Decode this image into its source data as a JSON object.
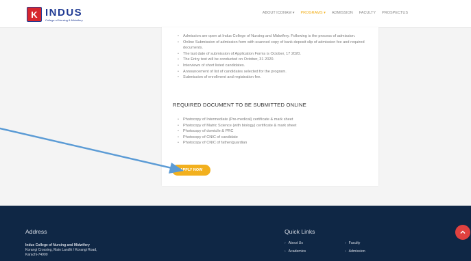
{
  "header": {
    "logo_letter": "K",
    "logo_title": "INDUS",
    "logo_subtitle": "College of Nursing & Midwifery",
    "nav": [
      {
        "label": "ABOUT ICONAM ▾"
      },
      {
        "label": "PROGRAMS ▾"
      },
      {
        "label": "ADMISSION"
      },
      {
        "label": "FACULTY"
      },
      {
        "label": "PROSPECTUS"
      }
    ]
  },
  "card": {
    "process_items": [
      "Admission are open at Indus College of Nursing and Midwifery. Following is the process of admission.",
      "Online Submission of admission form with scanned copy of bank deposit slip of admission fee and required documents.",
      "The last date of submission of Application Forms is October, 17 2020.",
      "The Entry test will be conducted on October, 31 2020.",
      "Interviews of short listed candidates.",
      "Announcement of list of candidates selected for the program.",
      "Submission of enrollment and registration fee."
    ],
    "section_title": "REQUIRED DOCUMENT TO BE SUBMITTED ONLINE",
    "document_items": [
      "Photocopy of Intermediate (Pre-medical) certificate & mark sheet",
      "Photocopy of Matric Science (with biology) certificate & mark sheet",
      "Photocopy of domicile & PRC",
      "Photocopy of CNIC of candidate",
      "Photocopy of CNIC of father/guardian"
    ],
    "apply_button": "APPLY NOW"
  },
  "footer": {
    "address_heading": "Address",
    "address_name": "Indus College of Nursing and Midwifery",
    "address_line1": "Korangi Crossing, Main Landhi / Korangi Road,",
    "address_line2": "Karachi-74900",
    "quick_links_heading": "Quick Links",
    "links": [
      {
        "label": "About Us"
      },
      {
        "label": "Faculty"
      },
      {
        "label": "Academics"
      },
      {
        "label": "Admission"
      }
    ],
    "scroll_top_icon": "chevron-up-icon"
  },
  "colors": {
    "accent": "#f2b01e",
    "brand": "#1f3a93",
    "footer_bg": "#0f2745",
    "scroll_top": "#e0413f",
    "annotation_arrow": "#5b9bd5"
  }
}
